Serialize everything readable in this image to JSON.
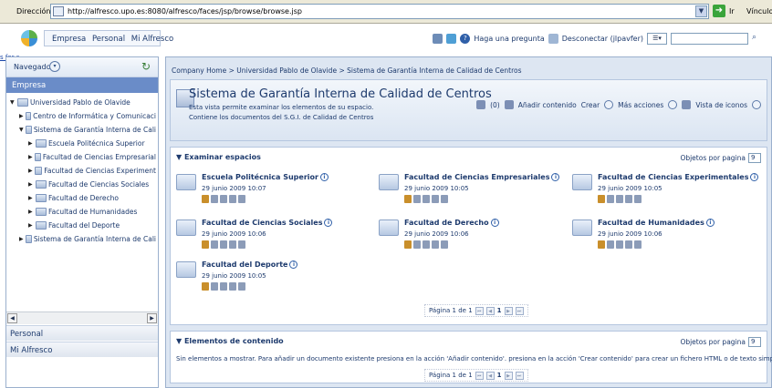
{
  "browser": {
    "address_label": "Dirección",
    "url": "http://alfresco.upo.es:8080/alfresco/faces/jsp/browse/browse.jsp",
    "go_label": "Ir",
    "links_label": "Vínculos"
  },
  "topbar": {
    "nav": [
      "Empresa",
      "Personal",
      "Mi Alfresco"
    ],
    "help_label": "Haga una pregunta",
    "logout_label": "Desconectar (jlpavfer)",
    "search_value": ""
  },
  "left_link": "s for s",
  "sidebar": {
    "title": "Navegador",
    "section_active": "Empresa",
    "tree": [
      {
        "label": "Universidad Pablo de Olavide",
        "level": 0,
        "expanded": true
      },
      {
        "label": "Centro de Informática y Comunicaci",
        "level": 1,
        "expanded": false
      },
      {
        "label": "Sistema de Garantía Interna de Cali",
        "level": 1,
        "expanded": true
      },
      {
        "label": "Escuela Politécnica Superior",
        "level": 2,
        "expanded": false
      },
      {
        "label": "Facultad de Ciencias Empresarial",
        "level": 2,
        "expanded": false
      },
      {
        "label": "Facultad de Ciencias Experiment",
        "level": 2,
        "expanded": false
      },
      {
        "label": "Facultad de Ciencias Sociales",
        "level": 2,
        "expanded": false
      },
      {
        "label": "Facultad de Derecho",
        "level": 2,
        "expanded": false
      },
      {
        "label": "Facultad de Humanidades",
        "level": 2,
        "expanded": false
      },
      {
        "label": "Facultad del Deporte",
        "level": 2,
        "expanded": false
      },
      {
        "label": "Sistema de Garantía Interna de Cali",
        "level": 1,
        "expanded": false
      }
    ],
    "sections": [
      "Personal",
      "Mi Alfresco"
    ]
  },
  "breadcrumb": "Company Home > Universidad Pablo de Olavide > Sistema de Garantía Interna de Calidad de Centros",
  "space_header": {
    "title": "Sistema de Garantía Interna de Calidad de Centros",
    "desc1": "Esta vista permite examinar los elementos de su espacio.",
    "desc2": "Contiene los documentos del S.G.I. de Calidad de Centros",
    "count": "(0)",
    "add_content": "Añadir contenido",
    "create": "Crear",
    "more_actions": "Más acciones",
    "view": "Vista de iconos"
  },
  "browse_spaces": {
    "title": "Examinar espacios",
    "per_page_label": "Objetos por pagina",
    "per_page": "9",
    "items": [
      {
        "name": "Escuela Politécnica Superior",
        "date": "29 junio 2009 10:07"
      },
      {
        "name": "Facultad de Ciencias Empresariales",
        "date": "29 junio 2009 10:05"
      },
      {
        "name": "Facultad de Ciencias Experimentales",
        "date": "29 junio 2009 10:05"
      },
      {
        "name": "Facultad de Ciencias Sociales",
        "date": "29 junio 2009 10:06"
      },
      {
        "name": "Facultad de Derecho",
        "date": "29 junio 2009 10:06"
      },
      {
        "name": "Facultad de Humanidades",
        "date": "29 junio 2009 10:06"
      },
      {
        "name": "Facultad del Deporte",
        "date": "29 junio 2009 10:05"
      }
    ],
    "pager_label": "Página 1 de 1",
    "current_page": "1"
  },
  "content_items": {
    "title": "Elementos de contenido",
    "per_page_label": "Objetos por pagina",
    "per_page": "9",
    "empty_text": "Sin elementos a mostrar. Para añadir un documento existente presiona en la acción 'Añadir contenido'. presiona en la acción 'Crear contenido' para crear un fichero HTML o de texto simple.",
    "pager_label": "Página 1 de 1",
    "current_page": "1"
  }
}
